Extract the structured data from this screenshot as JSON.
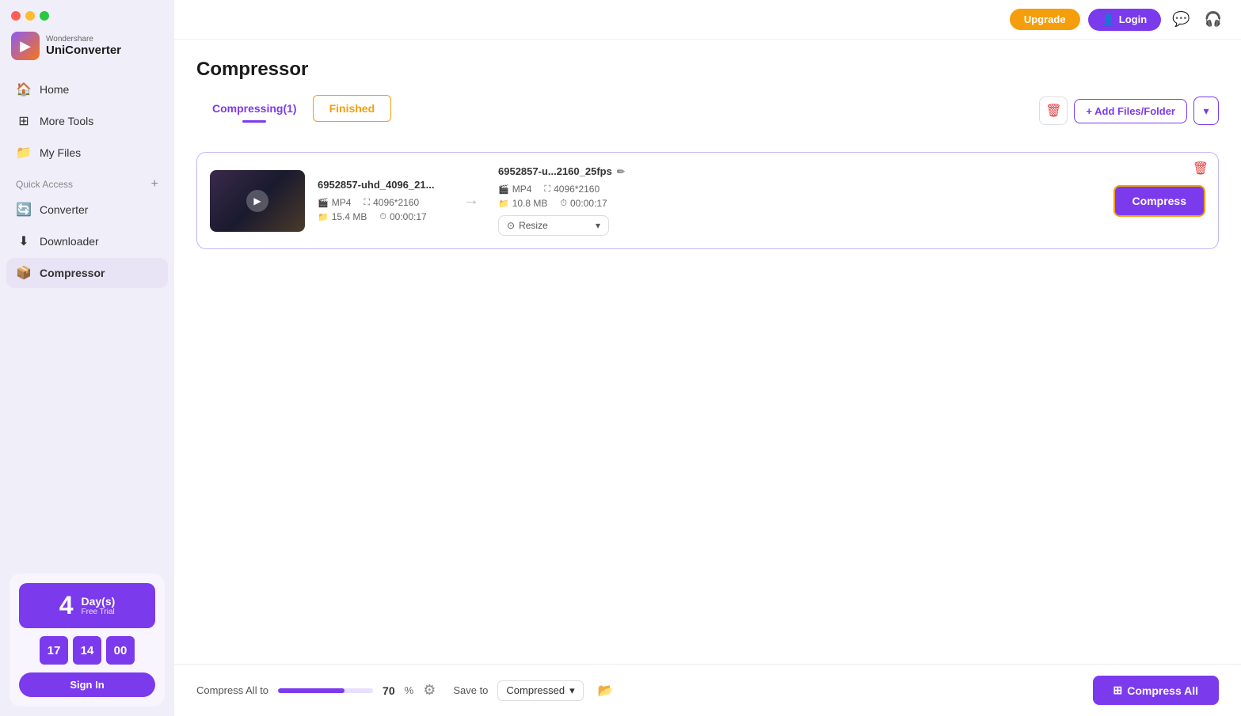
{
  "app": {
    "name": "UniConverter",
    "vendor": "Wondershare"
  },
  "topbar": {
    "upgrade_label": "Upgrade",
    "login_label": "Login"
  },
  "sidebar": {
    "nav_items": [
      {
        "id": "home",
        "label": "Home",
        "icon": "🏠"
      },
      {
        "id": "more-tools",
        "label": "More Tools",
        "icon": "⊞"
      },
      {
        "id": "my-files",
        "label": "My Files",
        "icon": "📁"
      }
    ],
    "quick_access_label": "Quick Access",
    "sub_nav_items": [
      {
        "id": "converter",
        "label": "Converter",
        "icon": "🔄"
      },
      {
        "id": "downloader",
        "label": "Downloader",
        "icon": "⬇"
      },
      {
        "id": "compressor",
        "label": "Compressor",
        "icon": "📦",
        "active": true
      }
    ],
    "trial": {
      "days_number": "4",
      "days_label": "Day(s)",
      "days_sublabel": "Free Trial",
      "digit1": "17",
      "digit2": "14",
      "digit3": "00",
      "signin_label": "Sign In"
    }
  },
  "page": {
    "title": "Compressor",
    "tabs": [
      {
        "id": "compressing",
        "label": "Compressing(1)",
        "active": true
      },
      {
        "id": "finished",
        "label": "Finished",
        "active": false
      }
    ]
  },
  "toolbar": {
    "add_files_label": "+ Add Files/Folder"
  },
  "file_item": {
    "source_name": "6952857-uhd_4096_21...",
    "source_format": "MP4",
    "source_resolution": "4096*2160",
    "source_size": "15.4 MB",
    "source_duration": "00:00:17",
    "output_name": "6952857-u...2160_25fps",
    "output_format": "MP4",
    "output_resolution": "4096*2160",
    "output_size": "10.8 MB",
    "output_duration": "00:00:17",
    "resize_label": "Resize",
    "compress_label": "Compress"
  },
  "bottom_bar": {
    "compress_all_to_label": "Compress All to",
    "percent_value": "70",
    "percent_sign": "%",
    "save_to_label": "Save to",
    "save_location": "Compressed",
    "progress_fill_pct": 70,
    "compress_all_label": "Compress All"
  }
}
